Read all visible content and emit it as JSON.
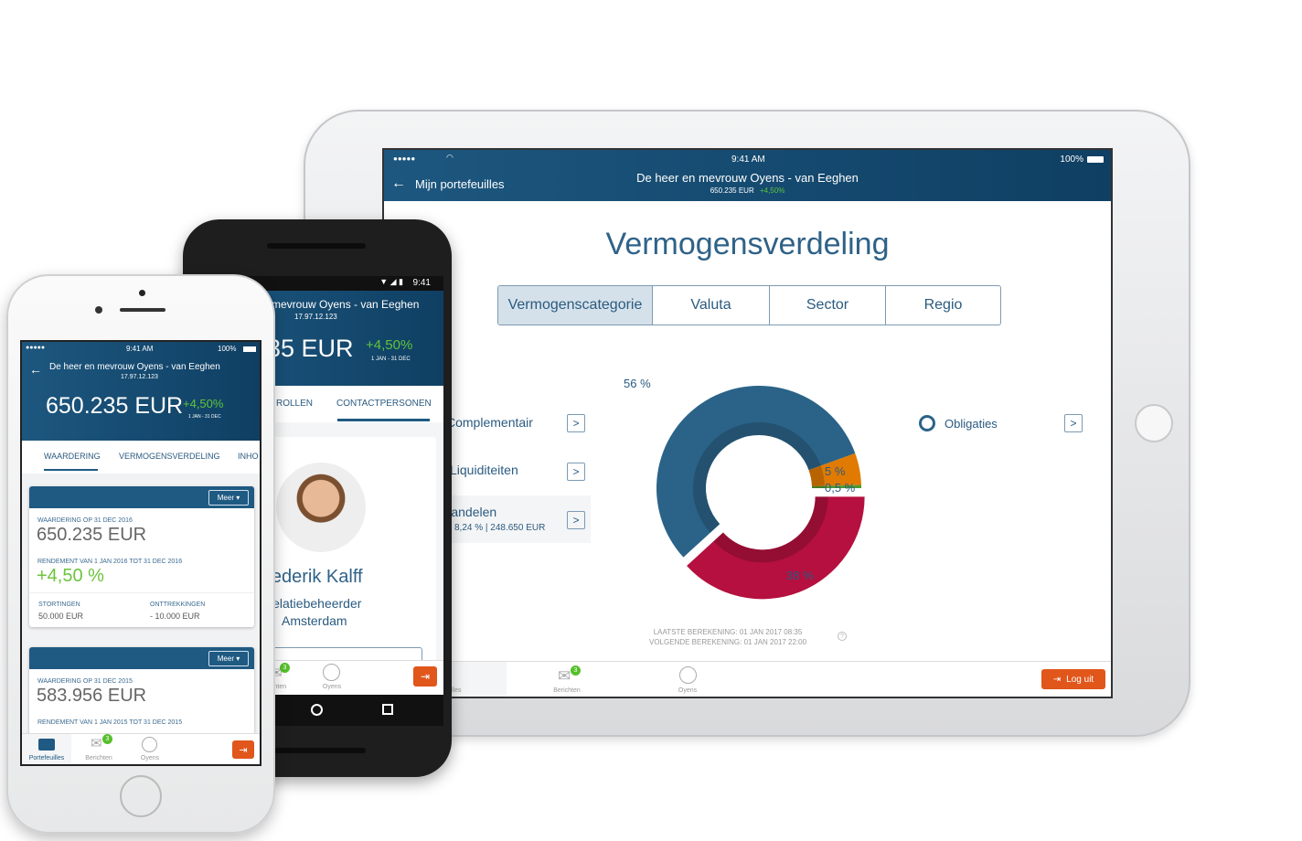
{
  "ipad": {
    "status": {
      "time": "9:41 AM",
      "battery": "100%",
      "signal": "●●●●●"
    },
    "back_label": "Mijn portefeuilles",
    "client_name": "De heer en mevrouw Oyens - van Eeghen",
    "total": "650.235 EUR",
    "change": "+4,50%",
    "title": "Vermogensverdeling",
    "tabs": [
      "Vermogenscategorie",
      "Valuta",
      "Sector",
      "Regio"
    ],
    "categories": [
      {
        "label": "Complementair"
      },
      {
        "label": "Liquiditeiten"
      },
      {
        "label": "Aandelen",
        "detail": "8,24 % | 248.650 EUR"
      }
    ],
    "legend_item": "Obligaties",
    "footer": [
      "LAATSTE BEREKENING: 01 JAN 2017 08:35",
      "VOLGENDE BEREKENING: 01 JAN 2017 22:00"
    ],
    "nav": [
      "lles",
      "Berichten",
      "Oyens"
    ],
    "badge": "3",
    "logout": "Log uit"
  },
  "chart_data": {
    "type": "pie",
    "variant": "donut",
    "slices": [
      {
        "label": "38 %",
        "value": 38,
        "color": "#b5103f",
        "exploded": true
      },
      {
        "label": "56 %",
        "value": 56,
        "color": "#2b6388"
      },
      {
        "label": "5 %",
        "value": 5,
        "color": "#e07a00"
      },
      {
        "label": "0,5 %",
        "value": 0.5,
        "color": "#4e9a2e"
      }
    ]
  },
  "android": {
    "time": "9:41",
    "client_name": "mevrouw Oyens - van Eeghen",
    "account": "17.97.12.123",
    "total": "35 EUR",
    "change": "+4,50%",
    "period": "1 JAN - 31 DEC",
    "tabs": [
      "ROLLEN",
      "CONTACTPERSONEN"
    ],
    "contact_name": "Frederik Kalff",
    "contact_role": "Relatiebeheerder",
    "contact_city": "Amsterdam",
    "nav": [
      "chten",
      "Oyens"
    ],
    "badge": "3"
  },
  "iphone": {
    "status": {
      "signal": "●●●●●",
      "time": "9:41 AM",
      "battery": "100%"
    },
    "client_name": "De heer en mevrouw Oyens - van Eeghen",
    "account": "17.97.12.123",
    "total": "650.235 EUR",
    "change": "+4,50%",
    "period": "1 JAN - 31 DEC",
    "tabs": [
      "WAARDERING",
      "VERMOGENSVERDELING",
      "INHO"
    ],
    "cards": [
      {
        "meer": "Meer",
        "val_label": "WAARDERING OP 31 DEC 2016",
        "value": "650.235 EUR",
        "rend_label": "RENDEMENT VAN 1 JAN 2016 TOT 31 DEC 2016",
        "rend": "+4,50 %",
        "stort_label": "STORTINGEN",
        "stort": "50.000 EUR",
        "ont_label": "ONTTREKKINGEN",
        "ont": "- 10.000 EUR"
      },
      {
        "meer": "Meer",
        "val_label": "WAARDERING OP 31 DEC 2015",
        "value": "583.956 EUR",
        "rend_label": "RENDEMENT VAN 1 JAN 2015 TOT 31 DEC 2015"
      }
    ],
    "nav": [
      "Portefeuilles",
      "Berichten",
      "Oyens"
    ],
    "badge": "3"
  }
}
